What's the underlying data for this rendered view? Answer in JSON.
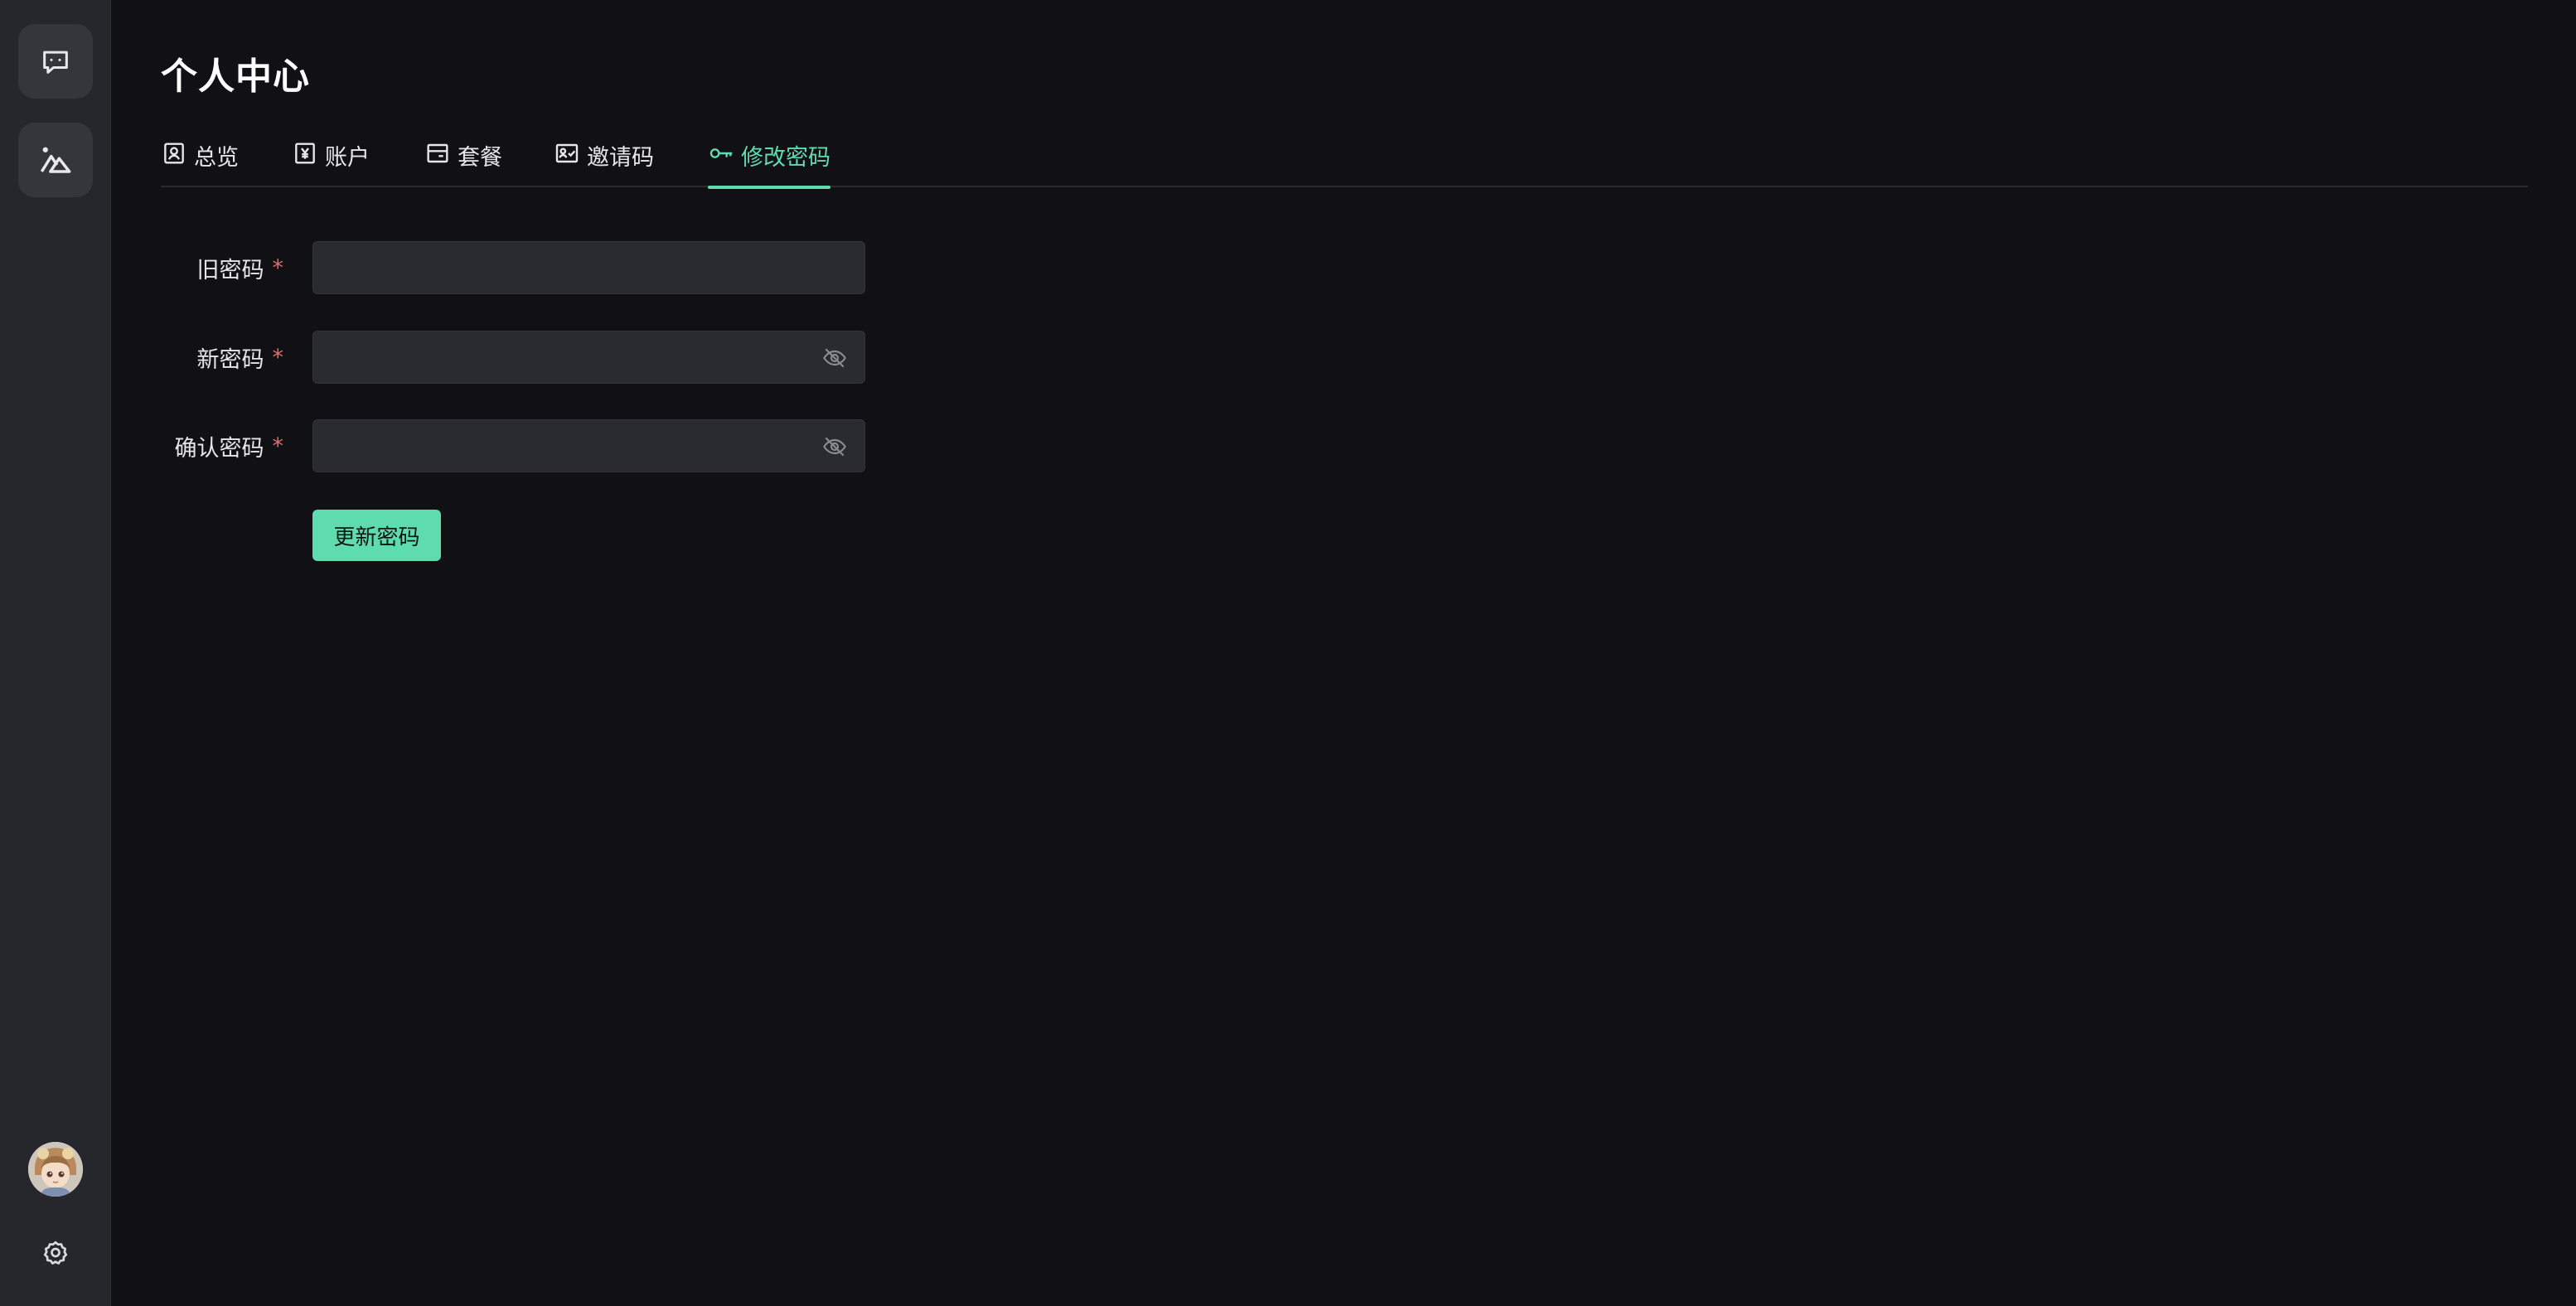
{
  "page": {
    "title": "个人中心"
  },
  "sidebar": {
    "items": [
      {
        "name": "chat",
        "icon": "chat-bubble-icon"
      },
      {
        "name": "image",
        "icon": "mountain-image-icon"
      }
    ],
    "avatar_icon": "user-avatar",
    "settings_icon": "gear-icon"
  },
  "tabs": [
    {
      "label": "总览",
      "icon": "profile-card-icon",
      "active": false
    },
    {
      "label": "账户",
      "icon": "yen-icon",
      "active": false
    },
    {
      "label": "套餐",
      "icon": "wallet-icon",
      "active": false
    },
    {
      "label": "邀请码",
      "icon": "id-card-check-icon",
      "active": false
    },
    {
      "label": "修改密码",
      "icon": "key-icon",
      "active": true
    }
  ],
  "form": {
    "old_password": {
      "label": "旧密码",
      "value": "",
      "placeholder": ""
    },
    "new_password": {
      "label": "新密码",
      "value": "",
      "placeholder": "",
      "toggle_icon": "eye-off-icon"
    },
    "confirm_password": {
      "label": "确认密码",
      "value": "",
      "placeholder": "",
      "toggle_icon": "eye-off-icon"
    },
    "required_mark": "*",
    "submit_label": "更新密码"
  },
  "colors": {
    "accent": "#5fdcae",
    "required": "#e26b6b",
    "background": "#111115",
    "sidebar": "#26272c",
    "input": "#2a2b30"
  }
}
